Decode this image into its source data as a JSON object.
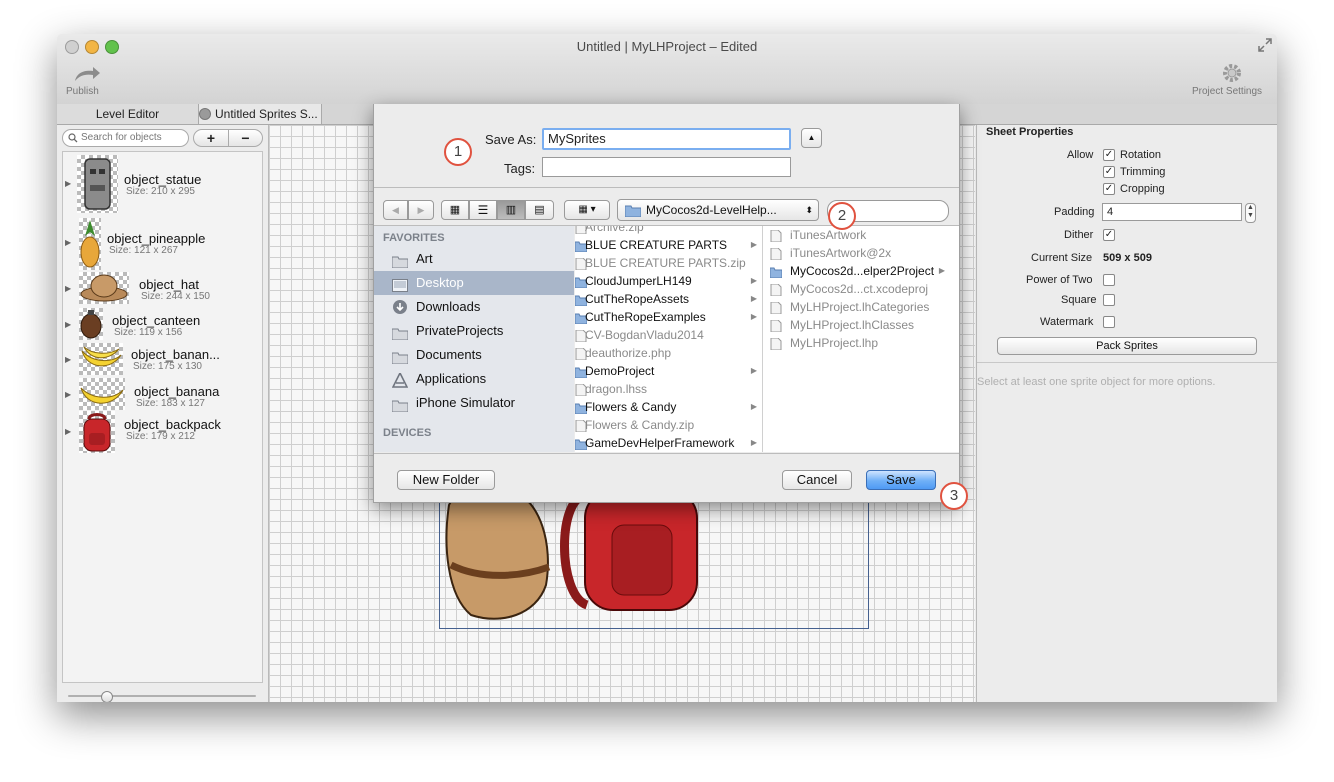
{
  "window": {
    "title": "Untitled | MyLHProject – Edited"
  },
  "toolbar": {
    "publish_label": "Publish",
    "settings_label": "Project Settings"
  },
  "tabs": [
    {
      "label": "Level Editor"
    },
    {
      "label": "Untitled Sprites S..."
    }
  ],
  "left_panel": {
    "search_placeholder": "Search for objects",
    "add_label": "+",
    "remove_label": "−",
    "objects": [
      {
        "name": "object_statue",
        "size": "Size: 210 x 295"
      },
      {
        "name": "object_pineapple",
        "size": "Size: 121 x 267"
      },
      {
        "name": "object_hat",
        "size": "Size: 244 x 150"
      },
      {
        "name": "object_canteen",
        "size": "Size: 119 x 156"
      },
      {
        "name": "object_banan...",
        "size": "Size: 175 x 130"
      },
      {
        "name": "object_banana",
        "size": "Size: 183 x 127"
      },
      {
        "name": "object_backpack",
        "size": "Size: 179 x 212"
      }
    ]
  },
  "save_sheet": {
    "save_as_label": "Save As:",
    "save_as_value": "MySprites",
    "tags_label": "Tags:",
    "tags_value": "",
    "location": "MyCocos2d-LevelHelp...",
    "search_value": "",
    "favorites_header": "FAVORITES",
    "devices_header": "DEVICES",
    "favorites": [
      {
        "label": "Art",
        "icon": "folder-icon"
      },
      {
        "label": "Desktop",
        "icon": "desktop-icon",
        "selected": true
      },
      {
        "label": "Downloads",
        "icon": "downloads-icon"
      },
      {
        "label": "PrivateProjects",
        "icon": "folder-icon"
      },
      {
        "label": "Documents",
        "icon": "folder-icon"
      },
      {
        "label": "Applications",
        "icon": "applications-icon"
      },
      {
        "label": "iPhone Simulator",
        "icon": "folder-icon"
      }
    ],
    "column1": [
      {
        "label": "Archive.zip",
        "dim": true,
        "folder": false
      },
      {
        "label": "BLUE CREATURE PARTS",
        "dim": false,
        "folder": true
      },
      {
        "label": "BLUE CREATURE PARTS.zip",
        "dim": true,
        "folder": false
      },
      {
        "label": "CloudJumperLH149",
        "dim": false,
        "folder": true
      },
      {
        "label": "CutTheRopeAssets",
        "dim": false,
        "folder": true
      },
      {
        "label": "CutTheRopeExamples",
        "dim": false,
        "folder": true
      },
      {
        "label": "CV-BogdanVladu2014",
        "dim": true,
        "folder": false
      },
      {
        "label": "deauthorize.php",
        "dim": true,
        "folder": false
      },
      {
        "label": "DemoProject",
        "dim": false,
        "folder": true
      },
      {
        "label": "dragon.lhss",
        "dim": true,
        "folder": false
      },
      {
        "label": "Flowers & Candy",
        "dim": false,
        "folder": true
      },
      {
        "label": "Flowers & Candy.zip",
        "dim": true,
        "folder": false
      },
      {
        "label": "GameDevHelperFramework",
        "dim": false,
        "folder": true
      }
    ],
    "column2": [
      {
        "label": "iTunesArtwork",
        "dim": true,
        "folder": false
      },
      {
        "label": "iTunesArtwork@2x",
        "dim": true,
        "folder": false
      },
      {
        "label": "MyCocos2d...elper2Project",
        "dim": false,
        "folder": true
      },
      {
        "label": "MyCocos2d...ct.xcodeproj",
        "dim": true,
        "folder": false
      },
      {
        "label": "MyLHProject.lhCategories",
        "dim": true,
        "folder": false
      },
      {
        "label": "MyLHProject.lhClasses",
        "dim": true,
        "folder": false
      },
      {
        "label": "MyLHProject.lhp",
        "dim": true,
        "folder": false
      }
    ],
    "new_folder_label": "New Folder",
    "cancel_label": "Cancel",
    "save_label": "Save"
  },
  "callouts": [
    "1",
    "2",
    "3"
  ],
  "sheet_properties": {
    "title": "Sheet Properties",
    "allow_label": "Allow",
    "rotation_label": "Rotation",
    "trimming_label": "Trimming",
    "cropping_label": "Cropping",
    "padding_label": "Padding",
    "padding_value": "4",
    "dither_label": "Dither",
    "current_size_label": "Current Size",
    "current_size_value": "509 x 509",
    "power_of_two_label": "Power of Two",
    "square_label": "Square",
    "watermark_label": "Watermark",
    "pack_button": "Pack Sprites",
    "hint": "Select at least one sprite object for more options."
  },
  "colors": {
    "selection": "#aab8cc",
    "accent_blue": "#4f9af4",
    "callout_red": "#e0523f"
  }
}
